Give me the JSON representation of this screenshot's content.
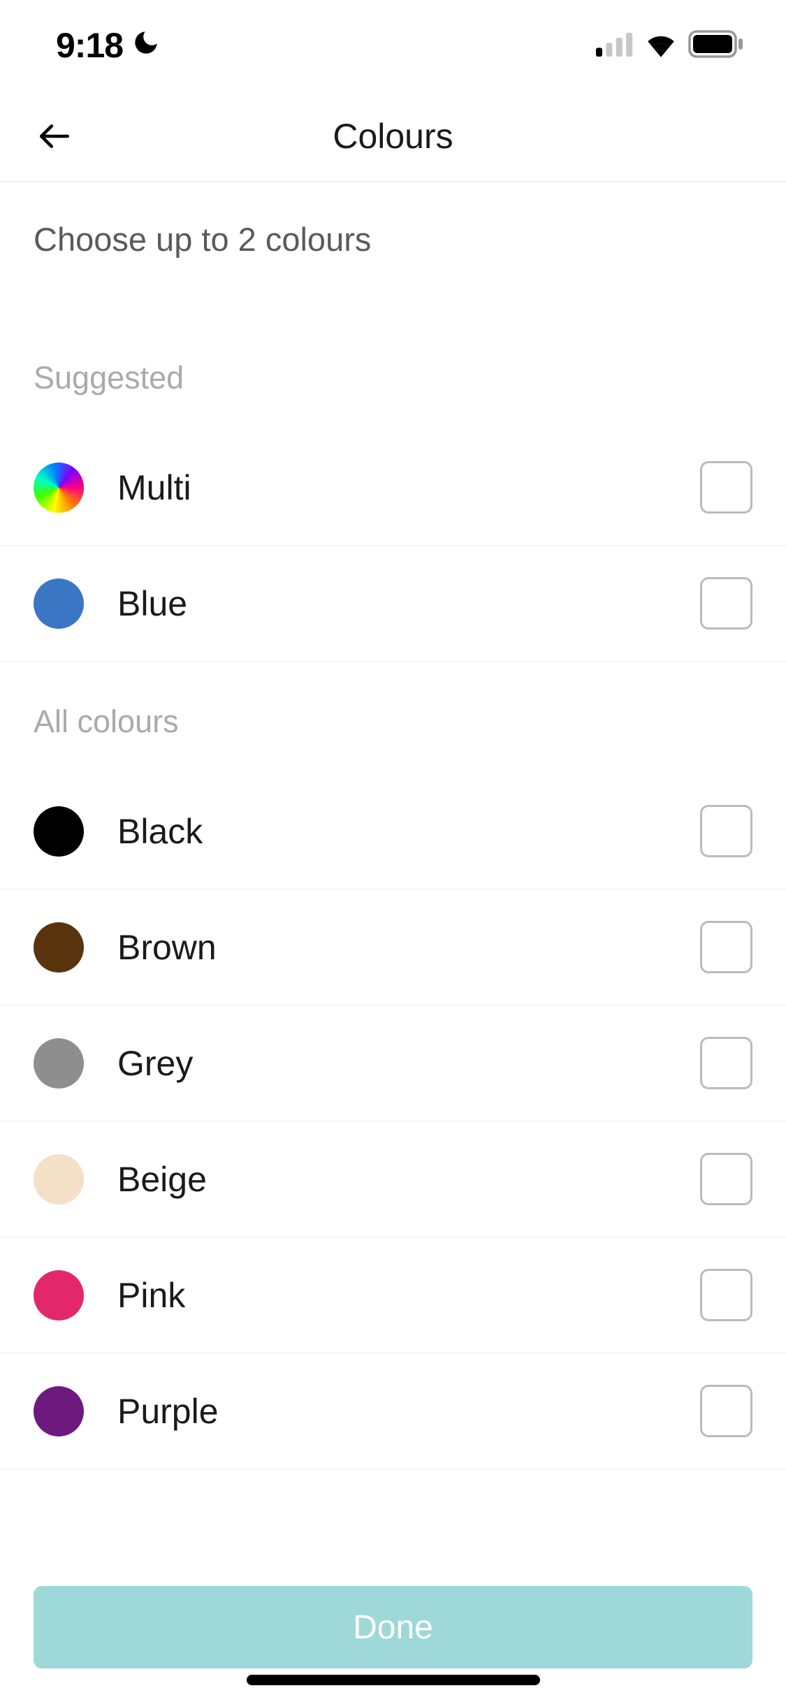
{
  "statusBar": {
    "time": "9:18"
  },
  "header": {
    "title": "Colours"
  },
  "instruction": "Choose up to 2 colours",
  "sections": {
    "suggested": {
      "label": "Suggested",
      "items": [
        {
          "name": "Multi",
          "swatch": "multi",
          "hex": ""
        },
        {
          "name": "Blue",
          "swatch": "solid",
          "hex": "#3b76c4"
        }
      ]
    },
    "all": {
      "label": "All colours",
      "items": [
        {
          "name": "Black",
          "swatch": "solid",
          "hex": "#000000"
        },
        {
          "name": "Brown",
          "swatch": "solid",
          "hex": "#5a330f"
        },
        {
          "name": "Grey",
          "swatch": "solid",
          "hex": "#8e8e8e"
        },
        {
          "name": "Beige",
          "swatch": "solid",
          "hex": "#f3e0c6"
        },
        {
          "name": "Pink",
          "swatch": "solid",
          "hex": "#e2286a"
        },
        {
          "name": "Purple",
          "swatch": "solid",
          "hex": "#6d1a7e"
        }
      ]
    }
  },
  "footer": {
    "doneLabel": "Done"
  }
}
